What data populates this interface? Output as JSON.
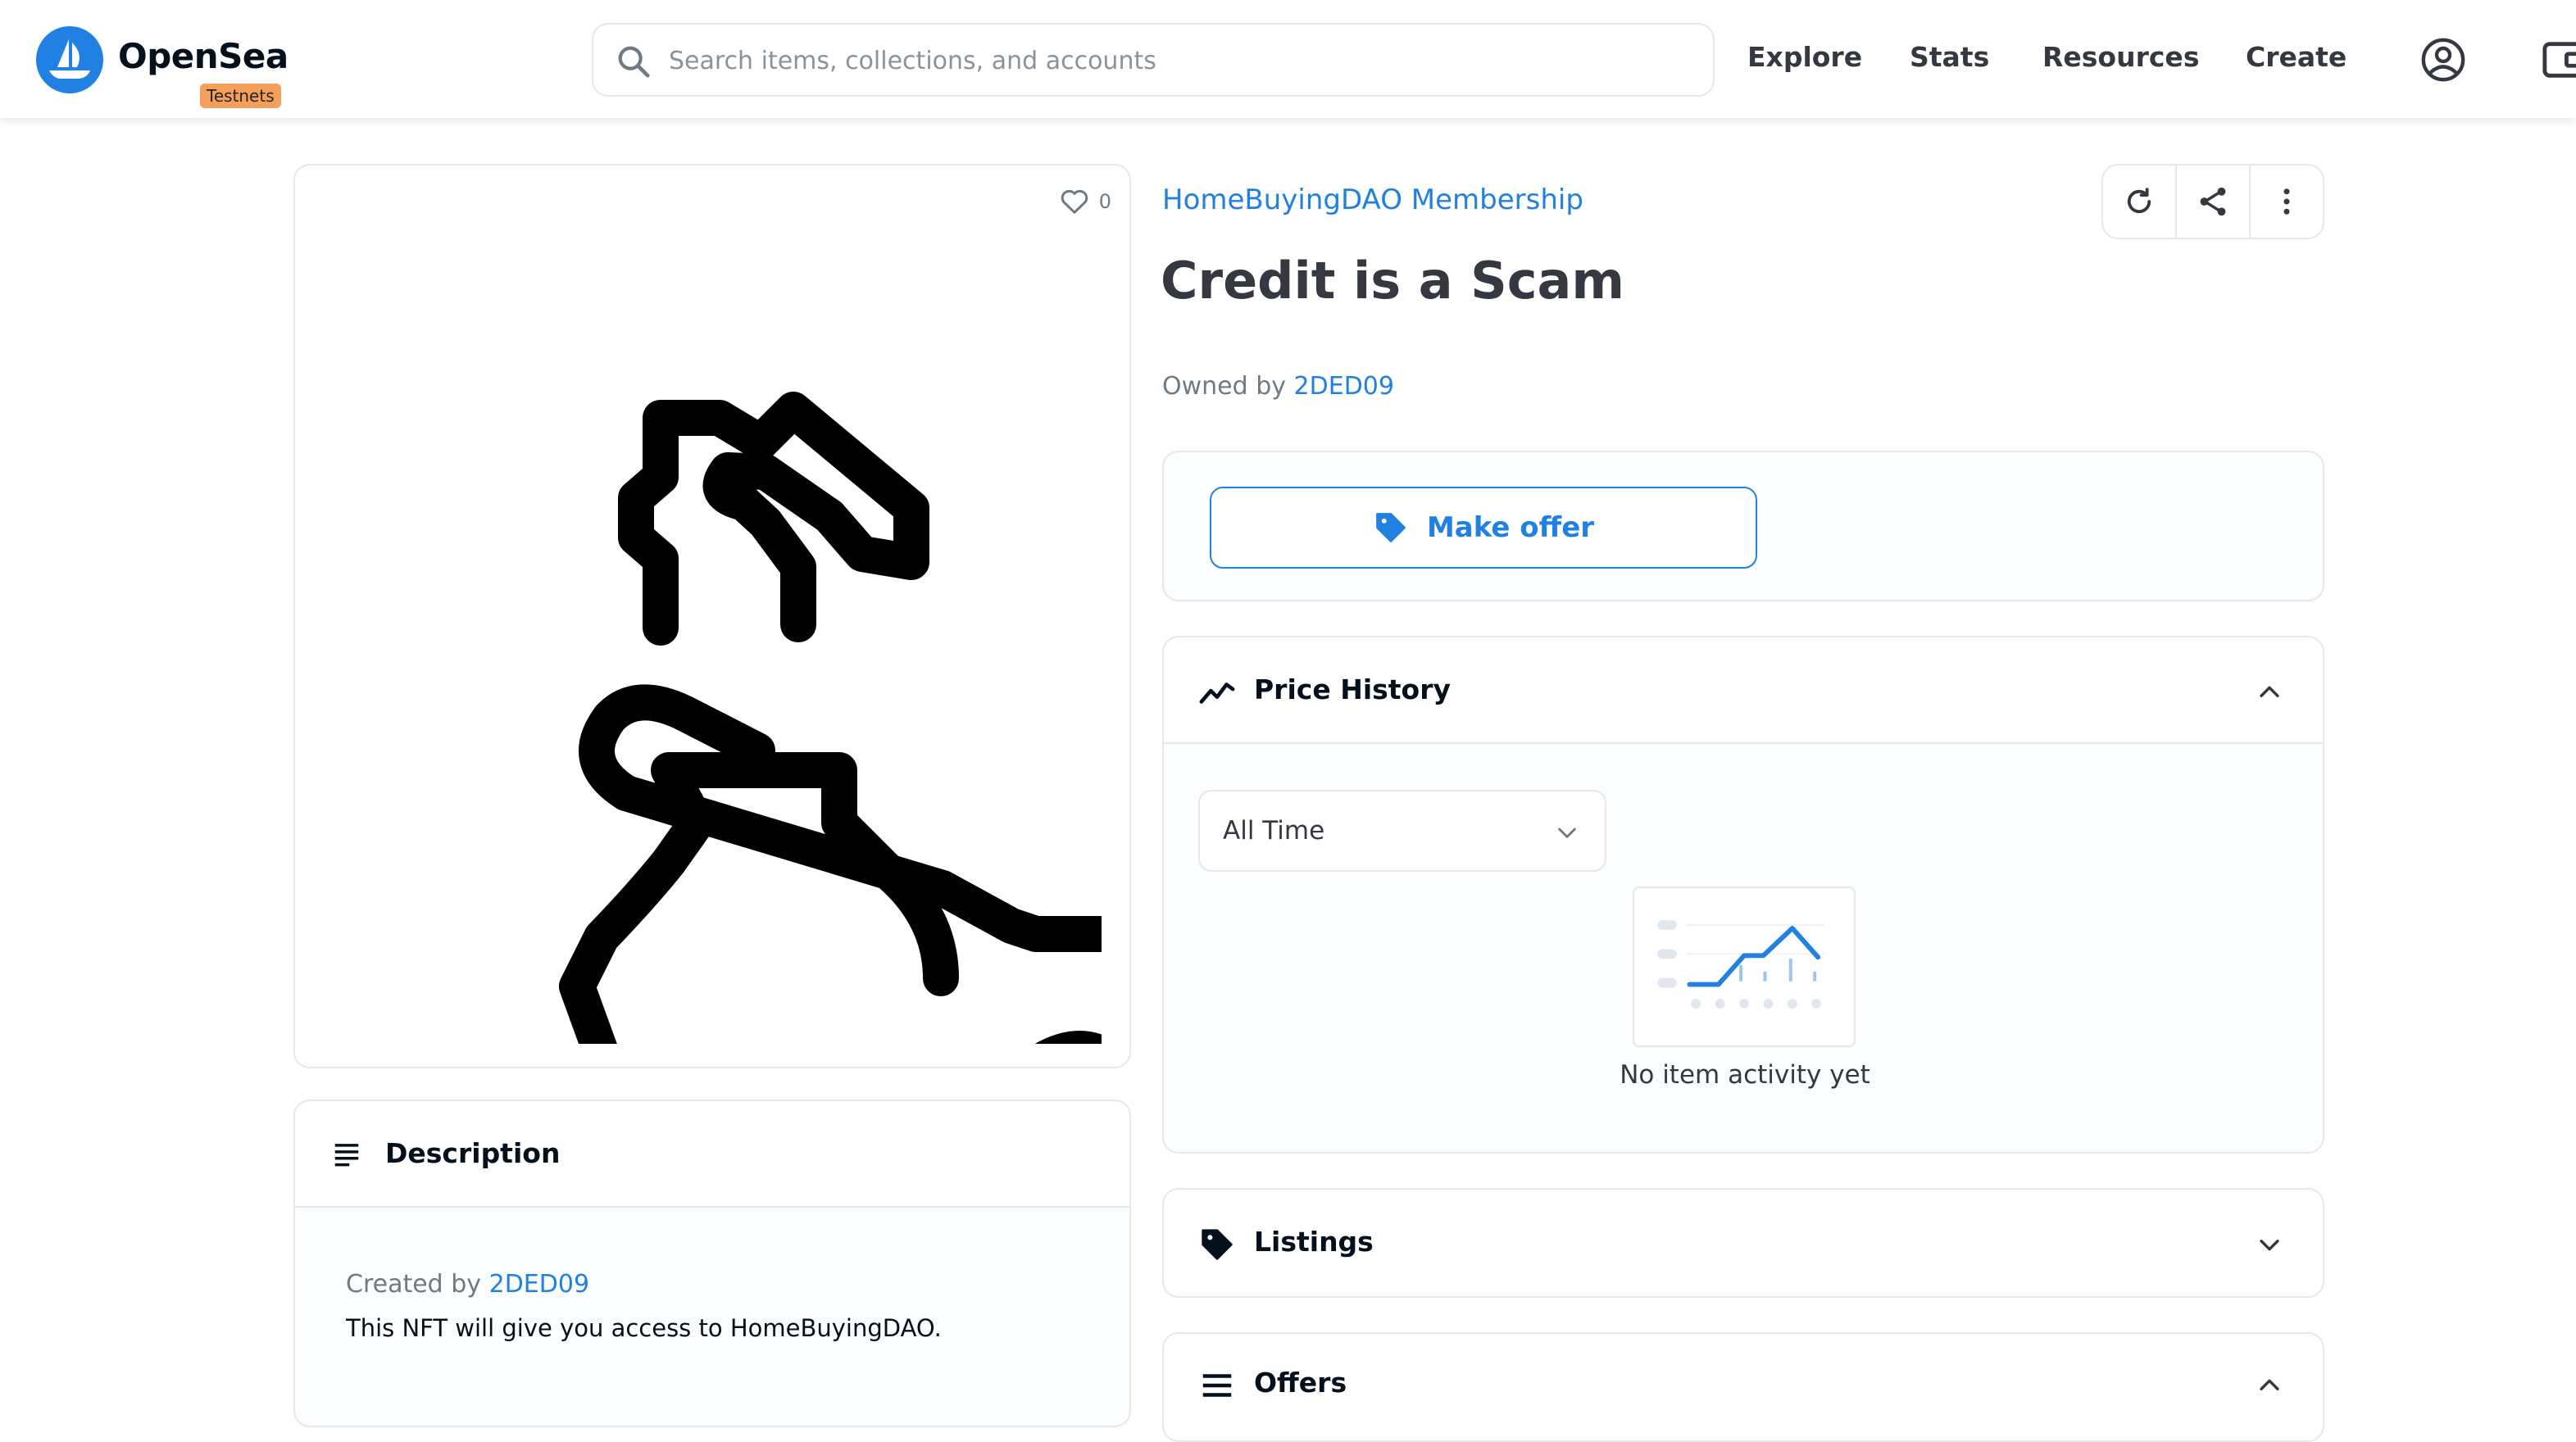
{
  "brand": {
    "name": "OpenSea",
    "badge": "Testnets",
    "accent": "#2081e2",
    "badge_color": "#f5a05a"
  },
  "search": {
    "placeholder": "Search items, collections, and accounts",
    "icon": "search-icon"
  },
  "nav": {
    "links": [
      "Explore",
      "Stats",
      "Resources",
      "Create"
    ],
    "account_icon": "account-icon",
    "wallet_icon": "wallet-icon"
  },
  "item": {
    "favorites": "0",
    "collection": "HomeBuyingDAO Membership",
    "title": "Credit is a Scam",
    "owned_by_label": "Owned by",
    "owner": "2DED09"
  },
  "actions": {
    "icons": [
      "refresh-icon",
      "share-icon",
      "more-icon"
    ]
  },
  "offer": {
    "button_label": "Make offer",
    "icon": "tag-icon"
  },
  "price_history": {
    "title": "Price History",
    "period": "All Time",
    "empty_message": "No item activity yet"
  },
  "description": {
    "title": "Description",
    "created_by_label": "Created by",
    "creator": "2DED09",
    "text": "This NFT will give you access to HomeBuyingDAO."
  },
  "sections": {
    "listings": "Listings",
    "offers": "Offers"
  }
}
